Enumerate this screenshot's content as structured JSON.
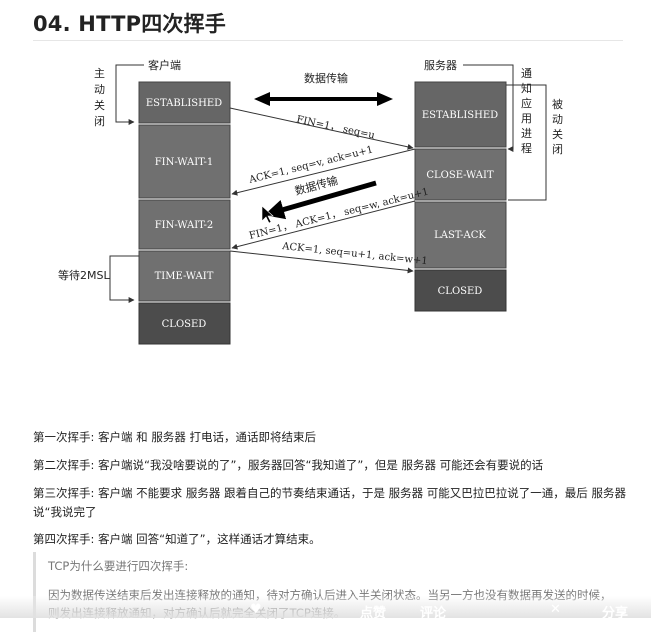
{
  "page": {
    "title": "04. HTTP四次挥手"
  },
  "diagram": {
    "client_label": "客户端",
    "server_label": "服务器",
    "client_states": [
      "ESTABLISHED",
      "FIN-WAIT-1",
      "FIN-WAIT-2",
      "TIME-WAIT",
      "CLOSED"
    ],
    "server_states": [
      "ESTABLISHED",
      "CLOSE-WAIT",
      "LAST-ACK",
      "CLOSED"
    ],
    "data_transfer_top": "数据传输",
    "data_transfer_mid": "数据传输",
    "active_close": [
      "主",
      "动",
      "关",
      "闭"
    ],
    "notify_app": [
      "通",
      "知",
      "应",
      "用",
      "进",
      "程"
    ],
    "passive_close": [
      "被",
      "动",
      "关",
      "闭"
    ],
    "wait_2msl": "等待2MSL",
    "messages": {
      "fin1": "FIN=1， seq=u",
      "ack1": "ACK=1, seq=v, ack=u+1",
      "fin2": "FIN=1， ACK=1， seq=w, ack=u+1",
      "ack2": "ACK=1, seq=u+1, ack=w+1"
    }
  },
  "paragraphs": {
    "p1": "第一次挥手: 客户端 和 服务器 打电话，通话即将结束后",
    "p2": "第二次挥手: 客户端说“我没啥要说的了”，服务器回答“我知道了”，但是 服务器 可能还会有要说的话",
    "p3": "第三次挥手: 客户端 不能要求 服务器 跟着自己的节奏结束通话，于是 服务器 可能又巴拉巴拉说了一通，最后 服务器 说“我说完了",
    "p4": "第四次挥手: 客户端 回答“知道了”，这样通话才算结束。"
  },
  "quote": {
    "title": "TCP为什么要进行四次挥手:",
    "body": "因为数据传送结束后发出连接释放的通知，待对方确认后进入半关闭状态。当另一方也没有数据再发送的时候，则发出连接释放通知，对方确认后就完全关闭了TCP连接。"
  },
  "toolbar": {
    "item1": "点赞",
    "item2": "评论",
    "item3": "分享"
  },
  "colors": {
    "box_dark": "#5f5f5f",
    "box_mid": "#767676",
    "box_closed": "#4a4a4a"
  }
}
